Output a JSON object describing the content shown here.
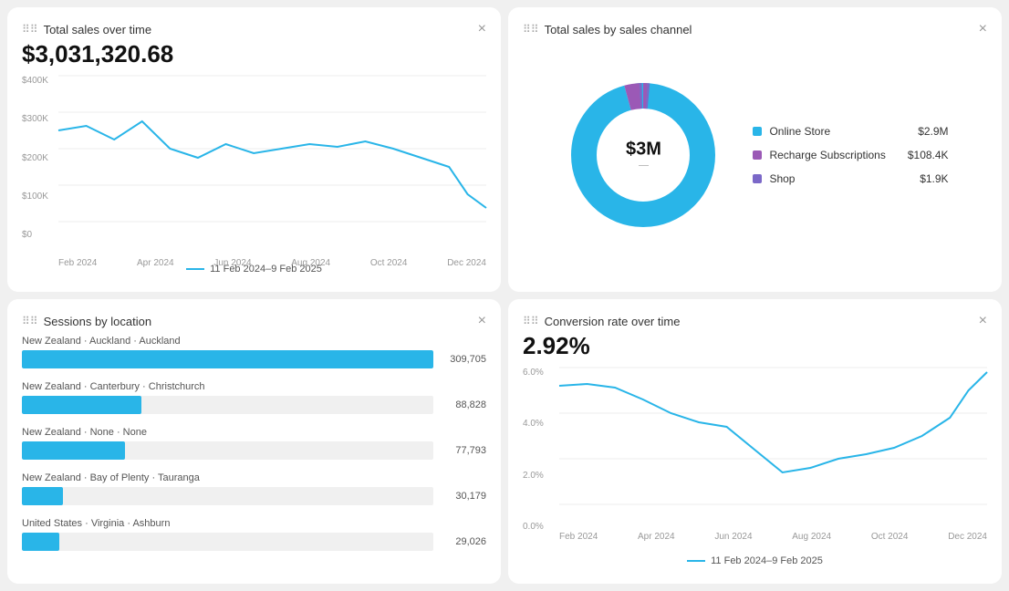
{
  "cards": {
    "total_sales": {
      "title": "Total sales over time",
      "close_label": "×",
      "big_value": "$3,031,320.68",
      "y_labels": [
        "$0",
        "$100K",
        "$200K",
        "$300K",
        "$400K"
      ],
      "x_labels": [
        "Feb 2024",
        "Apr 2024",
        "Jun 2024",
        "Aug 2024",
        "Oct 2024",
        "Dec 2024"
      ],
      "legend": "11 Feb 2024–9 Feb 2025"
    },
    "sales_by_channel": {
      "title": "Total sales by sales channel",
      "close_label": "×",
      "donut_center_value": "$3M",
      "donut_center_sub": "—",
      "legend_items": [
        {
          "label": "Online Store",
          "value": "$2.9M",
          "color": "#29b5e8"
        },
        {
          "label": "Recharge Subscriptions",
          "value": "$108.4K",
          "color": "#9b59b6"
        },
        {
          "label": "Shop",
          "value": "$1.9K",
          "color": "#7b68c8"
        }
      ]
    },
    "sessions_by_location": {
      "title": "Sessions by location",
      "close_label": "×",
      "locations": [
        {
          "label": "New Zealand · Auckland · Auckland",
          "value": 309705,
          "display": "309,705",
          "pct": 100
        },
        {
          "label": "New Zealand · Canterbury · Christchurch",
          "value": 88828,
          "display": "88,828",
          "pct": 29
        },
        {
          "label": "New Zealand · None · None",
          "value": 77793,
          "display": "77,793",
          "pct": 25
        },
        {
          "label": "New Zealand · Bay of Plenty · Tauranga",
          "value": 30179,
          "display": "30,179",
          "pct": 10
        },
        {
          "label": "United States · Virginia · Ashburn",
          "value": 29026,
          "display": "29,026",
          "pct": 9
        }
      ]
    },
    "conversion_rate": {
      "title": "Conversion rate over time",
      "close_label": "×",
      "big_value": "2.92%",
      "y_labels": [
        "0.0%",
        "2.0%",
        "4.0%",
        "6.0%"
      ],
      "x_labels": [
        "Feb 2024",
        "Apr 2024",
        "Jun 2024",
        "Aug 2024",
        "Oct 2024",
        "Dec 2024"
      ],
      "legend": "11 Feb 2024–9 Feb 2025"
    }
  },
  "icons": {
    "drag": "⠿",
    "close": "✕"
  }
}
